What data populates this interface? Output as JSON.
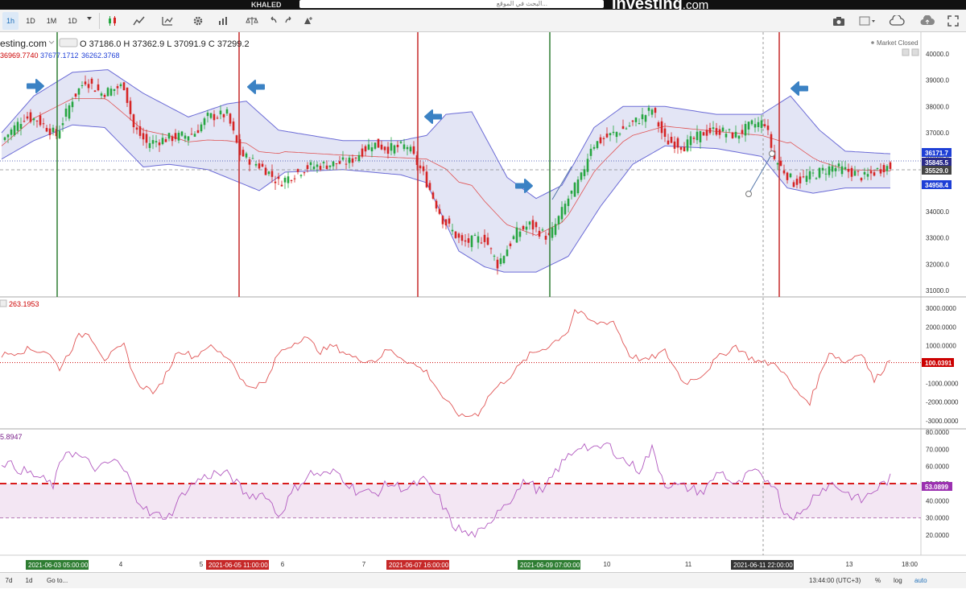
{
  "topbar": {
    "user": "KHALED",
    "search_placeholder": "البحث في الموقع...",
    "brand": "Investing",
    "brand_suffix": ".com"
  },
  "toolbar": {
    "intervals": [
      "1h",
      "1D",
      "1M",
      "1D"
    ],
    "right_icons": [
      "camera-icon",
      "color-box-icon",
      "cloud-save-icon",
      "cloud-upload-icon",
      "expand-icon"
    ]
  },
  "legend": {
    "symbol": "esting.com",
    "ohlc": "O 37186.0   H 37362.9   L 37091.9   C 37299.2",
    "bb_mid": "36969.7740",
    "bb_upper": "37677.1712",
    "bb_lower": "36262.3768",
    "market_status": "Market Closed",
    "osc_value": "263.1953",
    "rsi_value": "5.8947"
  },
  "price_labels": [
    {
      "text": "36171.7",
      "color": "#1e3fd6"
    },
    {
      "text": "35845.5",
      "color": "#2a2a8a"
    },
    {
      "text": "35529.0",
      "color": "#444444"
    },
    {
      "text": "34958.4",
      "color": "#1e3fd6"
    }
  ],
  "osc_label": {
    "text": "100.0391",
    "color": "#cc0000"
  },
  "rsi_label": {
    "text": "53.0899",
    "color": "#9b30b0"
  },
  "date_markers": [
    {
      "text": "2021-06-03 05:00:00",
      "color": "#2e7d32"
    },
    {
      "text": "2021-06-05 11:00:00",
      "color": "#c62828"
    },
    {
      "text": "2021-06-07 16:00:00",
      "color": "#c62828"
    },
    {
      "text": "2021-06-09 07:00:00",
      "color": "#2e7d32"
    },
    {
      "text": "2021-06-11 22:00:00",
      "color": "#333333"
    }
  ],
  "x_ticks": [
    "4",
    "5",
    "6",
    "7",
    "10",
    "11",
    "13",
    "18:00"
  ],
  "bottombar": {
    "range1": "7d",
    "range2": "1d",
    "goto": "Go to...",
    "time": "13:44:00 (UTC+3)",
    "pct": "%",
    "log": "log",
    "auto": "auto"
  },
  "chart_data": [
    {
      "type": "candlestick",
      "title": "",
      "ylim": [
        31000,
        40000
      ],
      "y_ticks": [
        31000,
        32000,
        33000,
        34000,
        35000,
        36000,
        37000,
        38000,
        39000,
        40000
      ],
      "close_path": [
        [
          0,
          36700
        ],
        [
          7,
          37600
        ],
        [
          11,
          37500
        ],
        [
          17,
          36900
        ],
        [
          22,
          38300
        ],
        [
          26,
          39000
        ],
        [
          31,
          38500
        ],
        [
          38,
          38800
        ],
        [
          41,
          37200
        ],
        [
          45,
          36600
        ],
        [
          52,
          36800
        ],
        [
          57,
          36900
        ],
        [
          60,
          37000
        ],
        [
          64,
          37600
        ],
        [
          70,
          37700
        ],
        [
          74,
          36200
        ],
        [
          82,
          35600
        ],
        [
          86,
          35100
        ],
        [
          95,
          35700
        ],
        [
          102,
          35800
        ],
        [
          108,
          35900
        ],
        [
          115,
          36600
        ],
        [
          120,
          36400
        ],
        [
          126,
          36500
        ],
        [
          131,
          35400
        ],
        [
          137,
          33700
        ],
        [
          143,
          32800
        ],
        [
          150,
          33000
        ],
        [
          154,
          32000
        ],
        [
          160,
          33200
        ],
        [
          164,
          33500
        ],
        [
          170,
          33000
        ],
        [
          176,
          34500
        ],
        [
          180,
          35300
        ],
        [
          183,
          36500
        ],
        [
          189,
          36900
        ],
        [
          194,
          37200
        ],
        [
          199,
          37600
        ],
        [
          202,
          37900
        ],
        [
          206,
          36700
        ],
        [
          212,
          36500
        ],
        [
          218,
          37000
        ],
        [
          222,
          37100
        ],
        [
          228,
          36900
        ],
        [
          233,
          37300
        ],
        [
          237,
          37400
        ],
        [
          240,
          36000
        ],
        [
          246,
          35100
        ],
        [
          252,
          35400
        ],
        [
          258,
          35700
        ],
        [
          264,
          35500
        ],
        [
          268,
          35300
        ],
        [
          274,
          35700
        ]
      ],
      "bands": {
        "upper_path": [
          [
            0,
            37000
          ],
          [
            10,
            38400
          ],
          [
            22,
            39300
          ],
          [
            33,
            39400
          ],
          [
            44,
            38500
          ],
          [
            58,
            37600
          ],
          [
            70,
            38100
          ],
          [
            76,
            38200
          ],
          [
            86,
            37100
          ],
          [
            106,
            36700
          ],
          [
            124,
            36700
          ],
          [
            132,
            36900
          ],
          [
            138,
            37700
          ],
          [
            146,
            37800
          ],
          [
            157,
            35300
          ],
          [
            166,
            34500
          ],
          [
            174,
            35000
          ],
          [
            184,
            37200
          ],
          [
            193,
            38000
          ],
          [
            206,
            38000
          ],
          [
            222,
            37700
          ],
          [
            236,
            37700
          ],
          [
            245,
            38400
          ],
          [
            254,
            37100
          ],
          [
            262,
            36300
          ],
          [
            276,
            36200
          ]
        ],
        "lower_path": [
          [
            0,
            36000
          ],
          [
            10,
            36700
          ],
          [
            22,
            37300
          ],
          [
            32,
            37200
          ],
          [
            44,
            35700
          ],
          [
            52,
            35800
          ],
          [
            64,
            35600
          ],
          [
            80,
            34800
          ],
          [
            88,
            35500
          ],
          [
            106,
            35600
          ],
          [
            124,
            35400
          ],
          [
            132,
            35100
          ],
          [
            142,
            32500
          ],
          [
            150,
            31900
          ],
          [
            156,
            31700
          ],
          [
            166,
            31700
          ],
          [
            176,
            32300
          ],
          [
            186,
            34200
          ],
          [
            196,
            35800
          ],
          [
            206,
            36500
          ],
          [
            222,
            36400
          ],
          [
            236,
            36100
          ],
          [
            244,
            34900
          ],
          [
            252,
            34700
          ],
          [
            262,
            34900
          ],
          [
            276,
            34900
          ]
        ],
        "colors": {
          "band": "#6b6bd6",
          "fill": "#e3e5f5",
          "middle": "#e05252"
        }
      },
      "candle_colors": {
        "up": "#26a641",
        "down": "#d62424"
      }
    },
    {
      "type": "line",
      "title": "",
      "ylim": [
        -3000,
        3000
      ],
      "y_ticks": [
        3000,
        2000,
        1000,
        0,
        -1000,
        -2000,
        -3000
      ],
      "y_tick_labels": [
        "3000.0000",
        "2000.0000",
        "1000.0000",
        "0",
        "-1000.0000",
        "-2000.0000",
        "-3000.0000"
      ],
      "reference_value": 100.0391,
      "color": "#e05555",
      "path": [
        [
          0,
          500
        ],
        [
          8,
          800
        ],
        [
          14,
          700
        ],
        [
          18,
          -200
        ],
        [
          24,
          1500
        ],
        [
          27,
          1700
        ],
        [
          32,
          300
        ],
        [
          38,
          1000
        ],
        [
          42,
          -1000
        ],
        [
          48,
          -1500
        ],
        [
          55,
          800
        ],
        [
          60,
          400
        ],
        [
          64,
          1000
        ],
        [
          71,
          300
        ],
        [
          76,
          -1200
        ],
        [
          82,
          -1000
        ],
        [
          86,
          600
        ],
        [
          94,
          1500
        ],
        [
          99,
          700
        ],
        [
          103,
          1000
        ],
        [
          110,
          300
        ],
        [
          116,
          200
        ],
        [
          120,
          800
        ],
        [
          126,
          200
        ],
        [
          132,
          -400
        ],
        [
          138,
          -2000
        ],
        [
          143,
          -2800
        ],
        [
          148,
          -2600
        ],
        [
          152,
          -1500
        ],
        [
          158,
          -600
        ],
        [
          164,
          500
        ],
        [
          170,
          1000
        ],
        [
          176,
          1800
        ],
        [
          178,
          2900
        ],
        [
          184,
          2200
        ],
        [
          190,
          2300
        ],
        [
          195,
          500
        ],
        [
          200,
          200
        ],
        [
          206,
          700
        ],
        [
          212,
          -1000
        ],
        [
          218,
          -500
        ],
        [
          222,
          300
        ],
        [
          228,
          1000
        ],
        [
          232,
          400
        ],
        [
          236,
          100
        ],
        [
          241,
          0
        ],
        [
          247,
          -1500
        ],
        [
          251,
          -2000
        ],
        [
          257,
          700
        ],
        [
          262,
          100
        ],
        [
          267,
          700
        ],
        [
          271,
          -900
        ],
        [
          276,
          300
        ]
      ]
    },
    {
      "type": "line",
      "title": "",
      "ylim": [
        15,
        80
      ],
      "y_ticks": [
        80,
        70,
        60,
        50,
        40,
        30,
        20
      ],
      "y_tick_labels": [
        "80.0000",
        "70.0000",
        "60.0000",
        "50.0000",
        "40.0000",
        "30.0000",
        "20.0000"
      ],
      "reference_lines": [
        50,
        30
      ],
      "color": "#b25ac0",
      "path": [
        [
          0,
          63
        ],
        [
          6,
          58
        ],
        [
          11,
          54
        ],
        [
          16,
          49
        ],
        [
          20,
          70
        ],
        [
          24,
          66
        ],
        [
          30,
          58
        ],
        [
          35,
          64
        ],
        [
          39,
          55
        ],
        [
          42,
          42
        ],
        [
          46,
          32
        ],
        [
          52,
          31
        ],
        [
          57,
          46
        ],
        [
          61,
          52
        ],
        [
          66,
          56
        ],
        [
          71,
          55
        ],
        [
          76,
          43
        ],
        [
          82,
          44
        ],
        [
          86,
          31
        ],
        [
          91,
          47
        ],
        [
          96,
          56
        ],
        [
          101,
          55
        ],
        [
          104,
          57
        ],
        [
          110,
          46
        ],
        [
          116,
          44
        ],
        [
          120,
          50
        ],
        [
          126,
          47
        ],
        [
          131,
          52
        ],
        [
          136,
          41
        ],
        [
          140,
          26
        ],
        [
          145,
          20
        ],
        [
          150,
          22
        ],
        [
          154,
          35
        ],
        [
          158,
          41
        ],
        [
          163,
          52
        ],
        [
          168,
          44
        ],
        [
          172,
          57
        ],
        [
          176,
          66
        ],
        [
          180,
          73
        ],
        [
          184,
          69
        ],
        [
          188,
          73
        ],
        [
          193,
          64
        ],
        [
          198,
          58
        ],
        [
          202,
          70
        ],
        [
          206,
          50
        ],
        [
          212,
          48
        ],
        [
          218,
          45
        ],
        [
          223,
          58
        ],
        [
          228,
          48
        ],
        [
          233,
          57
        ],
        [
          237,
          53
        ],
        [
          240,
          50
        ],
        [
          243,
          33
        ],
        [
          248,
          31
        ],
        [
          253,
          45
        ],
        [
          258,
          50
        ],
        [
          263,
          44
        ],
        [
          267,
          40
        ],
        [
          271,
          46
        ],
        [
          276,
          53
        ]
      ]
    }
  ]
}
